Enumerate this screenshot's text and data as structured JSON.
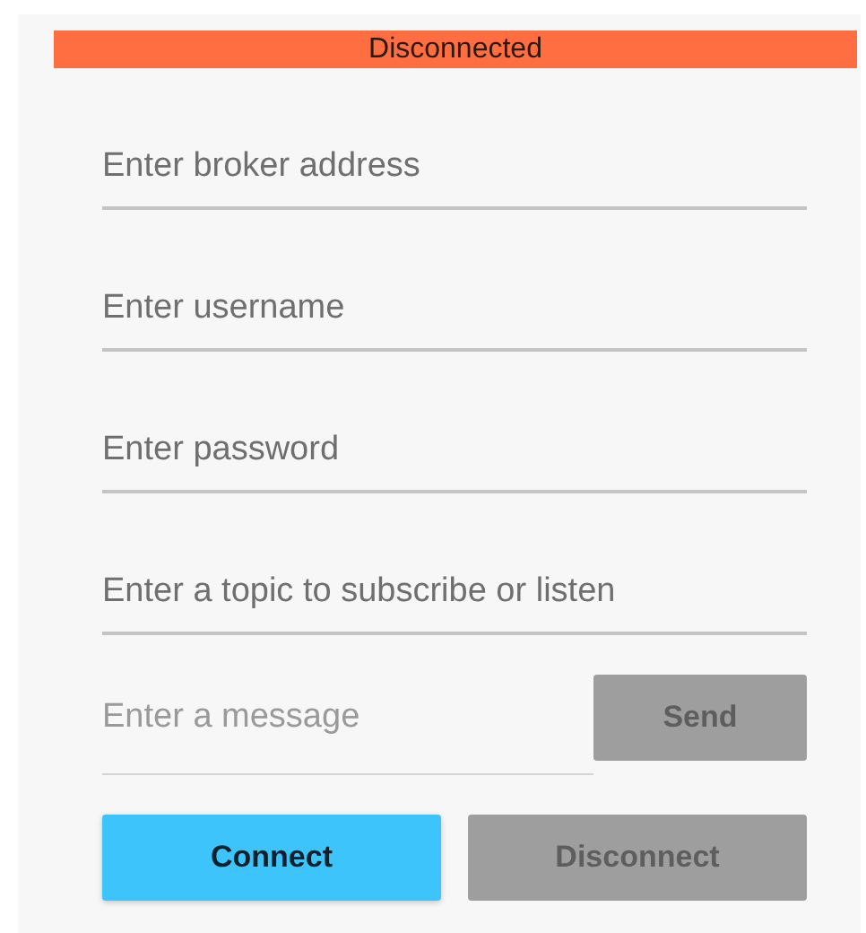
{
  "status": {
    "text": "Disconnected",
    "connected": false
  },
  "fields": [
    {
      "placeholder": "Enter broker address"
    },
    {
      "placeholder": "Enter username"
    },
    {
      "placeholder": "Enter password"
    },
    {
      "placeholder": "Enter a topic to subscribe or listen"
    }
  ],
  "message": {
    "placeholder": "Enter a message",
    "send": {
      "label": "Send",
      "disabled": true
    }
  },
  "buttons": [
    {
      "label": "Connect",
      "disabled": false
    },
    {
      "label": "Disconnect",
      "disabled": true
    }
  ]
}
